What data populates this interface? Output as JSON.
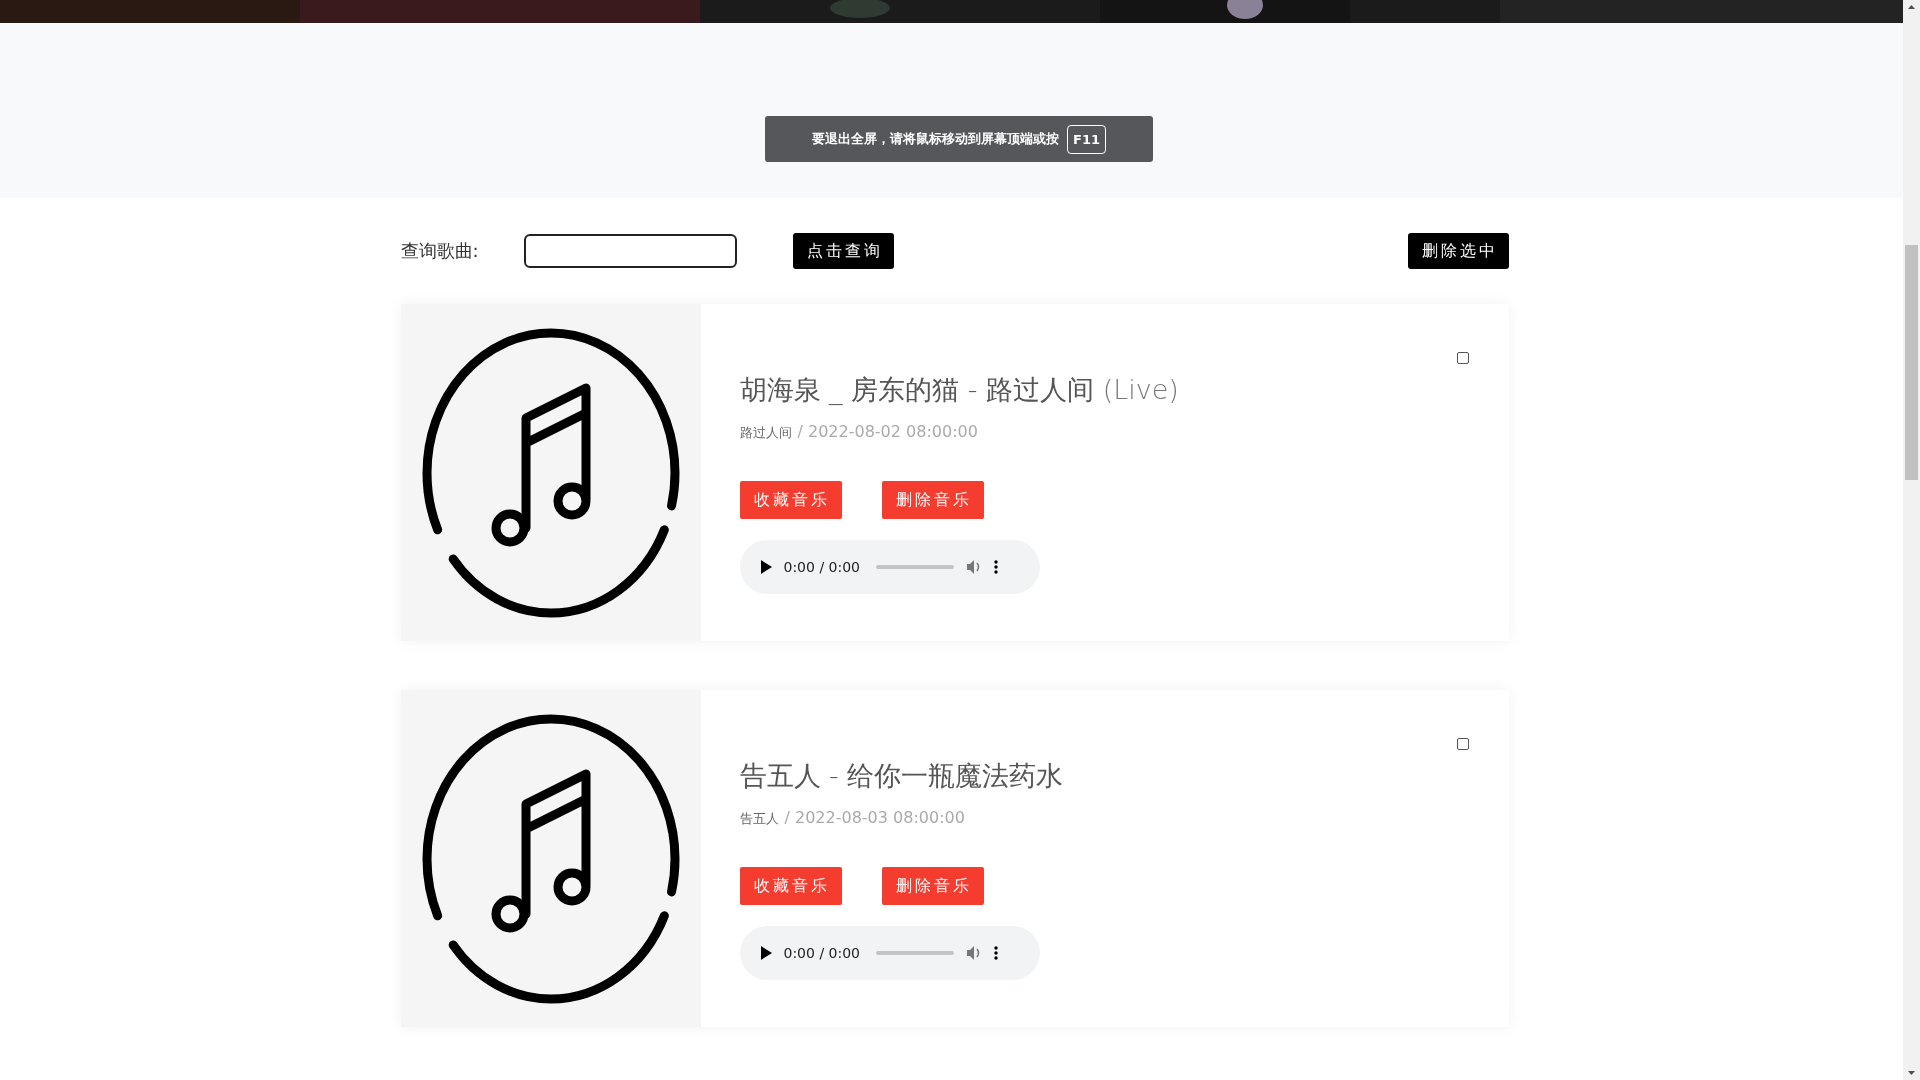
{
  "fullscreen_toast": {
    "message": "要退出全屏，请将鼠标移动到屏幕顶端或按",
    "key": "F11"
  },
  "search": {
    "label": "查询歌曲:",
    "button": "点击查询"
  },
  "delete_selected_button": "删除选中",
  "songs": [
    {
      "title": "胡海泉 _ 房东的猫 - 路过人间",
      "suffix": "(Live)",
      "album": "路过人间",
      "date": "/ 2022-08-02 08:00:00",
      "checked": false,
      "favorite_button": "收藏音乐",
      "delete_button": "删除音乐",
      "time": "0:00 / 0:00"
    },
    {
      "title": "告五人 - 给你一瓶魔法药水",
      "album": "告五人",
      "date": "/ 2022-08-03 08:00:00",
      "checked": false,
      "favorite_button": "收藏音乐",
      "delete_button": "删除音乐",
      "time": "0:00 / 0:00"
    }
  ]
}
